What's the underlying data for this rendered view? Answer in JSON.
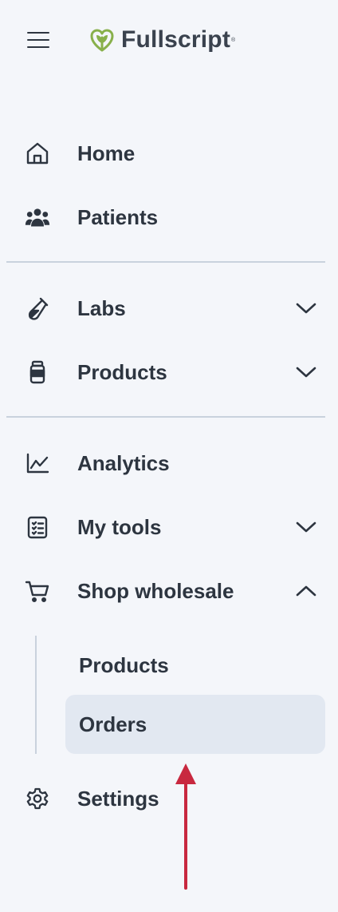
{
  "header": {
    "menu_icon": "hamburger-icon",
    "logo_text": "Fullscript",
    "logo_mark": "leaf-heart-icon",
    "brand_color": "#88b04b"
  },
  "nav": {
    "home": {
      "label": "Home",
      "icon": "home-icon"
    },
    "patients": {
      "label": "Patients",
      "icon": "users-icon"
    },
    "labs": {
      "label": "Labs",
      "icon": "test-tube-icon",
      "expanded": false
    },
    "products": {
      "label": "Products",
      "icon": "bottle-icon",
      "expanded": false
    },
    "analytics": {
      "label": "Analytics",
      "icon": "line-chart-icon"
    },
    "my_tools": {
      "label": "My tools",
      "icon": "checklist-icon",
      "expanded": false
    },
    "shop_wholesale": {
      "label": "Shop wholesale",
      "icon": "cart-icon",
      "expanded": true,
      "children": [
        {
          "label": "Products",
          "active": false
        },
        {
          "label": "Orders",
          "active": true
        }
      ]
    },
    "settings": {
      "label": "Settings",
      "icon": "gear-icon"
    }
  },
  "annotation": {
    "arrow_color": "#c8283f"
  },
  "colors": {
    "background": "#f4f6fa",
    "text": "#2d3540",
    "divider": "#c9d2dd",
    "active_bg": "#e2e8f1"
  }
}
